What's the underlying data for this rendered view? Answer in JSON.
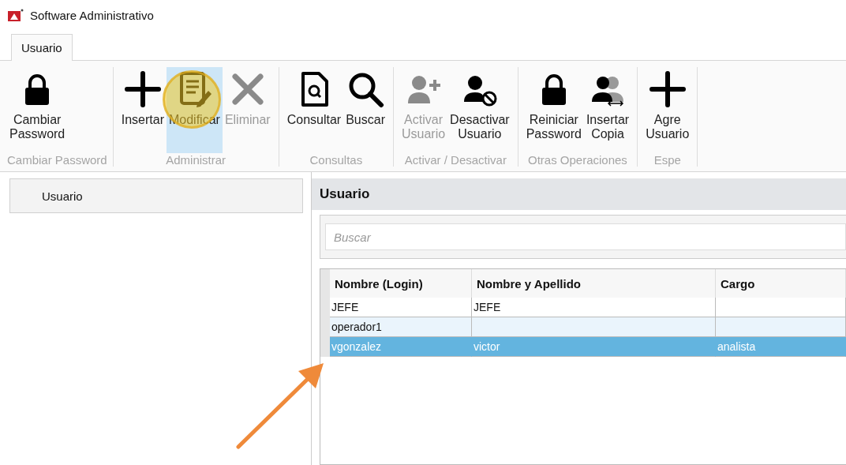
{
  "window": {
    "title": "Software Administrativo"
  },
  "tabs": [
    {
      "label": "Usuario",
      "selected": true
    }
  ],
  "ribbon": {
    "groups": [
      {
        "label": "Cambiar Password",
        "buttons": [
          {
            "kind": "lock",
            "lines": [
              "Cambiar",
              "Password"
            ],
            "disabled": false,
            "selected": false
          }
        ]
      },
      {
        "label": "Administrar",
        "buttons": [
          {
            "kind": "plus",
            "lines": [
              "Insertar"
            ],
            "disabled": false,
            "selected": false
          },
          {
            "kind": "edit",
            "lines": [
              "Modificar"
            ],
            "disabled": false,
            "selected": true
          },
          {
            "kind": "delete",
            "lines": [
              "Eliminar"
            ],
            "disabled": true,
            "selected": false
          }
        ]
      },
      {
        "label": "Consultas",
        "buttons": [
          {
            "kind": "doc-search",
            "lines": [
              "Consultar"
            ],
            "disabled": false,
            "selected": false
          },
          {
            "kind": "search",
            "lines": [
              "Buscar"
            ],
            "disabled": false,
            "selected": false
          }
        ]
      },
      {
        "label": "Activar / Desactivar",
        "buttons": [
          {
            "kind": "user-add",
            "lines": [
              "Activar",
              "Usuario"
            ],
            "disabled": true,
            "selected": false
          },
          {
            "kind": "user-block",
            "lines": [
              "Desactivar",
              "Usuario"
            ],
            "disabled": false,
            "selected": false
          }
        ]
      },
      {
        "label": "Otras Operaciones",
        "buttons": [
          {
            "kind": "lock",
            "lines": [
              "Reiniciar",
              "Password"
            ],
            "disabled": false,
            "selected": false
          },
          {
            "kind": "users-copy",
            "lines": [
              "Insertar",
              "Copia"
            ],
            "disabled": false,
            "selected": false
          }
        ]
      },
      {
        "label": "Espe",
        "buttons": [
          {
            "kind": "plus",
            "lines": [
              "Agre",
              "Usuario"
            ],
            "disabled": false,
            "selected": false
          }
        ]
      }
    ]
  },
  "sidebar": {
    "items": [
      {
        "label": "Usuario",
        "selected": false
      }
    ]
  },
  "panel": {
    "title": "Usuario",
    "search": {
      "placeholder": "Buscar"
    },
    "table": {
      "columns": [
        "Nombre (Login)",
        "Nombre y Apellido",
        "Cargo"
      ],
      "rows": [
        {
          "cells": [
            "JEFE",
            "JEFE",
            ""
          ],
          "selected": false
        },
        {
          "cells": [
            "operador1",
            "",
            ""
          ],
          "selected": false
        },
        {
          "cells": [
            "vgonzalez",
            "victor",
            "analista"
          ],
          "selected": true
        }
      ]
    }
  }
}
